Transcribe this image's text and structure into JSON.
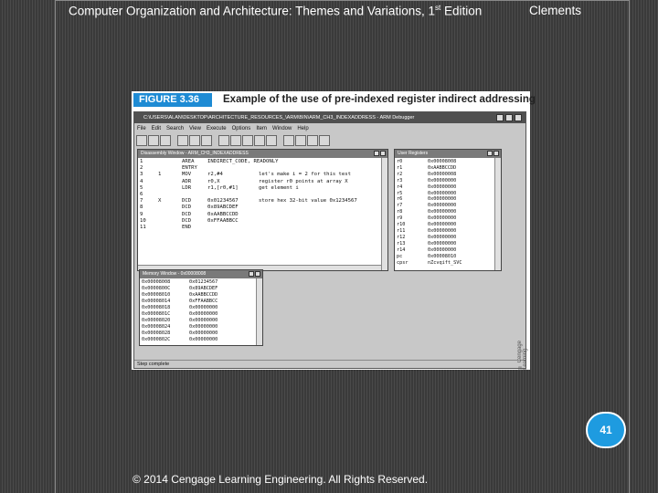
{
  "header": {
    "book_title": "Computer Organization and Architecture: Themes and Variations, 1",
    "edition_sup": "st",
    "edition_tail": " Edition",
    "author": "Clements"
  },
  "figure": {
    "label": "FIGURE 3.36",
    "caption": "Example of the use of pre-indexed register indirect addressing",
    "side_credit": "© Cengage Learning"
  },
  "app": {
    "title": "C:\\USERS\\ALAN\\DESKTOP\\ARCHITECTURE_RESOURCES_\\ARM\\BIN\\ARM_CH3_INDEXADDRESS - ARM Debugger",
    "menu": [
      "File",
      "Edit",
      "Search",
      "View",
      "Execute",
      "Options",
      "Item",
      "Window",
      "Help"
    ],
    "status": "Step complete"
  },
  "disassembly": {
    "title": "Disassembly Window - ARM_CH3_INDEXADDRESS",
    "lines": [
      {
        "num": "1",
        "mark": "",
        "op": "AREA",
        "args": "INDIRECT_CODE, READONLY",
        "comment": ""
      },
      {
        "num": "2",
        "mark": "",
        "op": "ENTRY",
        "args": "",
        "comment": ""
      },
      {
        "num": "3",
        "mark": "1",
        "op": "MOV",
        "args": "r2,#4",
        "comment": "let's make i = 2 for this test"
      },
      {
        "num": "4",
        "mark": "",
        "op": "ADR",
        "args": "r0,X",
        "comment": "register r0 points at array X"
      },
      {
        "num": "5",
        "mark": "",
        "op": "LDR",
        "args": "r1,[r0,#1]",
        "comment": "get element i"
      },
      {
        "num": "6",
        "mark": "",
        "op": "",
        "args": "",
        "comment": ""
      },
      {
        "num": "7",
        "mark": "X",
        "op": "DCD",
        "args": "0x01234567",
        "comment": "store hex 32-bit value 0x1234567"
      },
      {
        "num": "8",
        "mark": "",
        "op": "DCD",
        "args": "0x89ABCDEF",
        "comment": ""
      },
      {
        "num": "9",
        "mark": "",
        "op": "DCD",
        "args": "0xAABBCCDD",
        "comment": ""
      },
      {
        "num": "10",
        "mark": "",
        "op": "DCD",
        "args": "0xFFAABBCC",
        "comment": ""
      },
      {
        "num": "11",
        "mark": "",
        "op": "END",
        "args": "",
        "comment": ""
      }
    ]
  },
  "registers": {
    "title": "User Registers",
    "rows": [
      {
        "reg": "r0",
        "val": "0x00008008"
      },
      {
        "reg": "r1",
        "val": "0xAABBCCDD"
      },
      {
        "reg": "r2",
        "val": "0x00000008"
      },
      {
        "reg": "r3",
        "val": "0x00000000"
      },
      {
        "reg": "r4",
        "val": "0x00000000"
      },
      {
        "reg": "r5",
        "val": "0x00000000"
      },
      {
        "reg": "r6",
        "val": "0x00000000"
      },
      {
        "reg": "r7",
        "val": "0x00000000"
      },
      {
        "reg": "r8",
        "val": "0x00000000"
      },
      {
        "reg": "r9",
        "val": "0x00000000"
      },
      {
        "reg": "r10",
        "val": "0x00000000"
      },
      {
        "reg": "r11",
        "val": "0x00000000"
      },
      {
        "reg": "r12",
        "val": "0x00000000"
      },
      {
        "reg": "r13",
        "val": "0x00000000"
      },
      {
        "reg": "r14",
        "val": "0x00000000"
      },
      {
        "reg": "pc",
        "val": "0x00008010"
      },
      {
        "reg": "cpsr",
        "val": "nZcvqift_SVC"
      }
    ]
  },
  "memory": {
    "title": "Memory Window - 0x00008008",
    "rows": [
      {
        "addr": "0x00008008",
        "val": "0x01234567"
      },
      {
        "addr": "0x0000800C",
        "val": "0x89ABCDEF"
      },
      {
        "addr": "0x00008010",
        "val": "0xAABBCCDD"
      },
      {
        "addr": "0x00008014",
        "val": "0xFFAABBCC"
      },
      {
        "addr": "0x00008018",
        "val": "0x00000000"
      },
      {
        "addr": "0x0000801C",
        "val": "0x00000000"
      },
      {
        "addr": "0x00008020",
        "val": "0x00000000"
      },
      {
        "addr": "0x00008024",
        "val": "0x00000000"
      },
      {
        "addr": "0x00008028",
        "val": "0x00000000"
      },
      {
        "addr": "0x0000802C",
        "val": "0x00000000"
      }
    ]
  },
  "slide": {
    "page_number": "41",
    "copyright": "© 2014 Cengage Learning Engineering. All Rights Reserved."
  },
  "colors": {
    "accent": "#1e9be0",
    "background": "#3c3c3c"
  }
}
